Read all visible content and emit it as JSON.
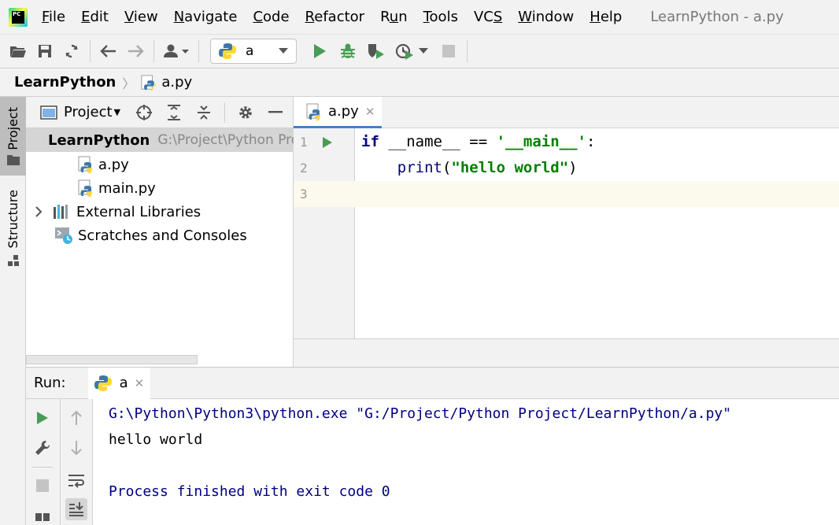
{
  "menubar": {
    "items": [
      {
        "label": "File",
        "u": "F",
        "rest": "ile"
      },
      {
        "label": "Edit",
        "u": "E",
        "rest": "dit"
      },
      {
        "label": "View",
        "u": "V",
        "rest": "iew"
      },
      {
        "label": "Navigate",
        "u": "N",
        "rest": "avigate"
      },
      {
        "label": "Code",
        "u": "C",
        "rest": "ode"
      },
      {
        "label": "Refactor",
        "u": "R",
        "rest": "efactor"
      },
      {
        "label": "Run",
        "pre": "R",
        "u": "u",
        "rest": "n"
      },
      {
        "label": "Tools",
        "u": "T",
        "rest": "ools"
      },
      {
        "label": "VCS",
        "pre": "VC",
        "u": "S",
        "rest": ""
      },
      {
        "label": "Window",
        "u": "W",
        "rest": "indow"
      },
      {
        "label": "Help",
        "u": "H",
        "rest": "elp"
      }
    ],
    "window_title": "LearnPython - a.py",
    "logo_text": "PC"
  },
  "toolbar": {
    "run_config": "a"
  },
  "breadcrumb": {
    "project": "LearnPython",
    "file": "a.py"
  },
  "stripe": {
    "project": "Project",
    "structure": "Structure"
  },
  "project_panel": {
    "title": "Project",
    "root": {
      "name": "LearnPython",
      "path": "G:\\Project\\Python Project\\LearnPython"
    },
    "files": [
      "a.py",
      "main.py"
    ],
    "external": "External Libraries",
    "scratches": "Scratches and Consoles"
  },
  "editor": {
    "tab": "a.py",
    "line_numbers": [
      "1",
      "2",
      "3"
    ],
    "code": {
      "l1_kw": "if",
      "l1_mid": " __name__ == ",
      "l1_str": "'__main__'",
      "l1_end": ":",
      "l2_indent": "    ",
      "l2_fn": "print",
      "l2_open": "(",
      "l2_str": "\"hello world\"",
      "l2_close": ")"
    }
  },
  "run_panel": {
    "title": "Run:",
    "tab": "a",
    "console": {
      "command": "G:\\Python\\Python3\\python.exe \"G:/Project/Python Project/LearnPython/a.py\"",
      "output": "hello world",
      "exit": "Process finished with exit code 0"
    }
  },
  "colors": {
    "run_green": "#499c54",
    "tab_accent": "#4083c9",
    "keyword": "#000080",
    "string": "#008000"
  }
}
